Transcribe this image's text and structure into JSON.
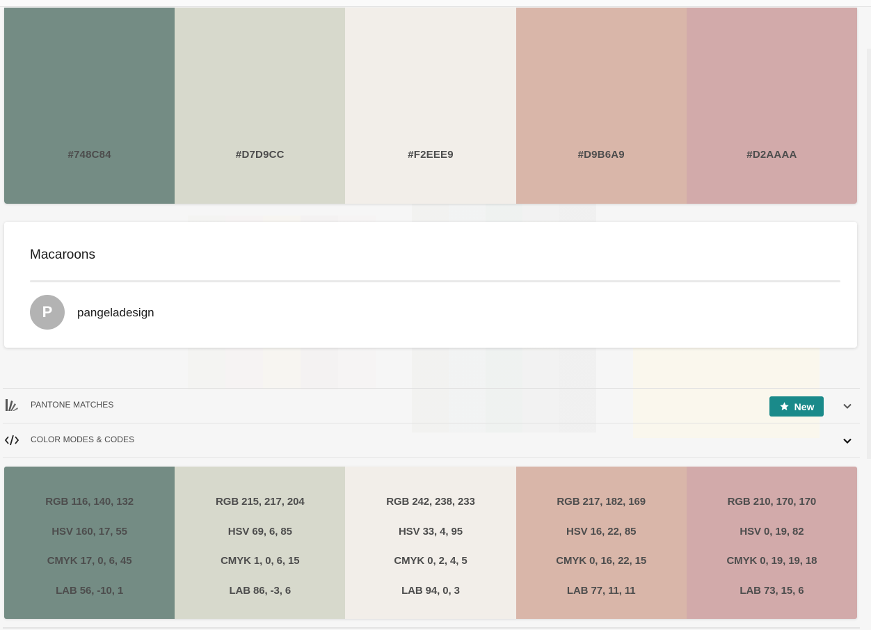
{
  "palette": {
    "swatches": [
      {
        "hex": "#748C84",
        "color": "#748C84"
      },
      {
        "hex": "#D7D9CC",
        "color": "#D7D9CC"
      },
      {
        "hex": "#F2EEE9",
        "color": "#F2EEE9"
      },
      {
        "hex": "#D9B6A9",
        "color": "#D9B6A9"
      },
      {
        "hex": "#D2AAAA",
        "color": "#D2AAAA"
      }
    ]
  },
  "card": {
    "title": "Macaroons",
    "author_initial": "P",
    "author": "pangeladesign"
  },
  "sections": {
    "pantone": {
      "label": "PANTONE MATCHES",
      "badge": "New",
      "icon": "pantone-fan-icon"
    },
    "codes": {
      "label": "COLOR MODES & CODES",
      "icon": "code-brackets-icon"
    }
  },
  "codes": [
    {
      "rgb": "RGB 116, 140, 132",
      "hsv": "HSV 160, 17, 55",
      "cmyk": "CMYK 17, 0, 6, 45",
      "lab": "LAB 56, -10, 1"
    },
    {
      "rgb": "RGB 215, 217, 204",
      "hsv": "HSV 69, 6, 85",
      "cmyk": "CMYK 1, 0, 6, 15",
      "lab": "LAB 86, -3, 6"
    },
    {
      "rgb": "RGB 242, 238, 233",
      "hsv": "HSV 33, 4, 95",
      "cmyk": "CMYK 0, 2, 4, 5",
      "lab": "LAB 94, 0, 3"
    },
    {
      "rgb": "RGB 217, 182, 169",
      "hsv": "HSV 16, 22, 85",
      "cmyk": "CMYK 0, 16, 22, 15",
      "lab": "LAB 77, 11, 11"
    },
    {
      "rgb": "RGB 210, 170, 170",
      "hsv": "HSV 0, 19, 82",
      "cmyk": "CMYK 0, 19, 19, 18",
      "lab": "LAB 73, 15, 6"
    }
  ],
  "colors": {
    "accent": "#1a8a8a"
  }
}
